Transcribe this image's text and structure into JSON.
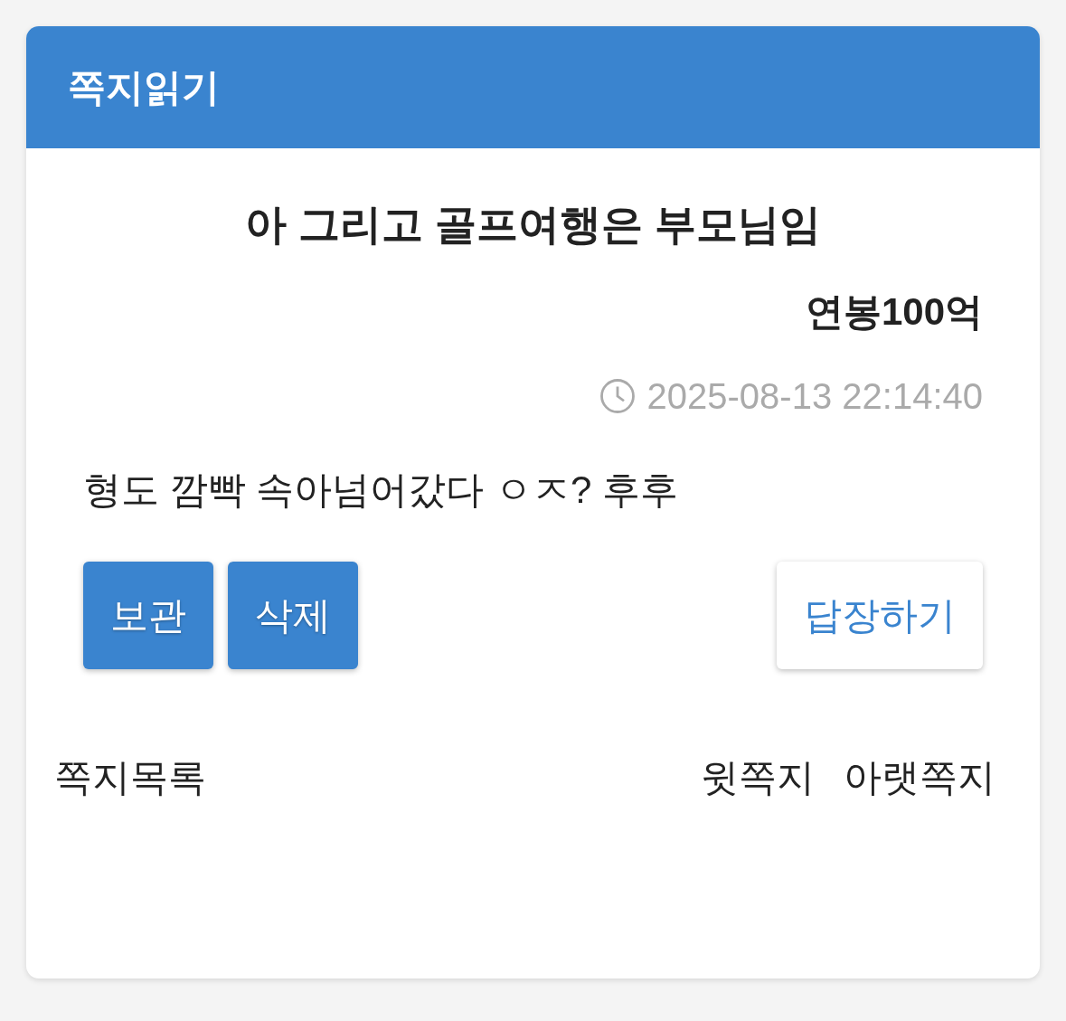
{
  "header": {
    "title": "쪽지읽기"
  },
  "message": {
    "subject": "아 그리고 골프여행은 부모님임",
    "sender": "연봉100억",
    "time": "2025-08-13 22:14:40",
    "body": "형도 깜빡 속아넘어갔다 ㅇㅈ? 후후"
  },
  "buttons": [
    {
      "label": "보관",
      "kind": "primary"
    },
    {
      "label": "삭제",
      "kind": "primary"
    },
    {
      "label": "답장하기",
      "kind": "outline"
    }
  ],
  "nav": {
    "list": "쪽지목록",
    "prev": "윗쪽지",
    "next": "아랫쪽지"
  }
}
